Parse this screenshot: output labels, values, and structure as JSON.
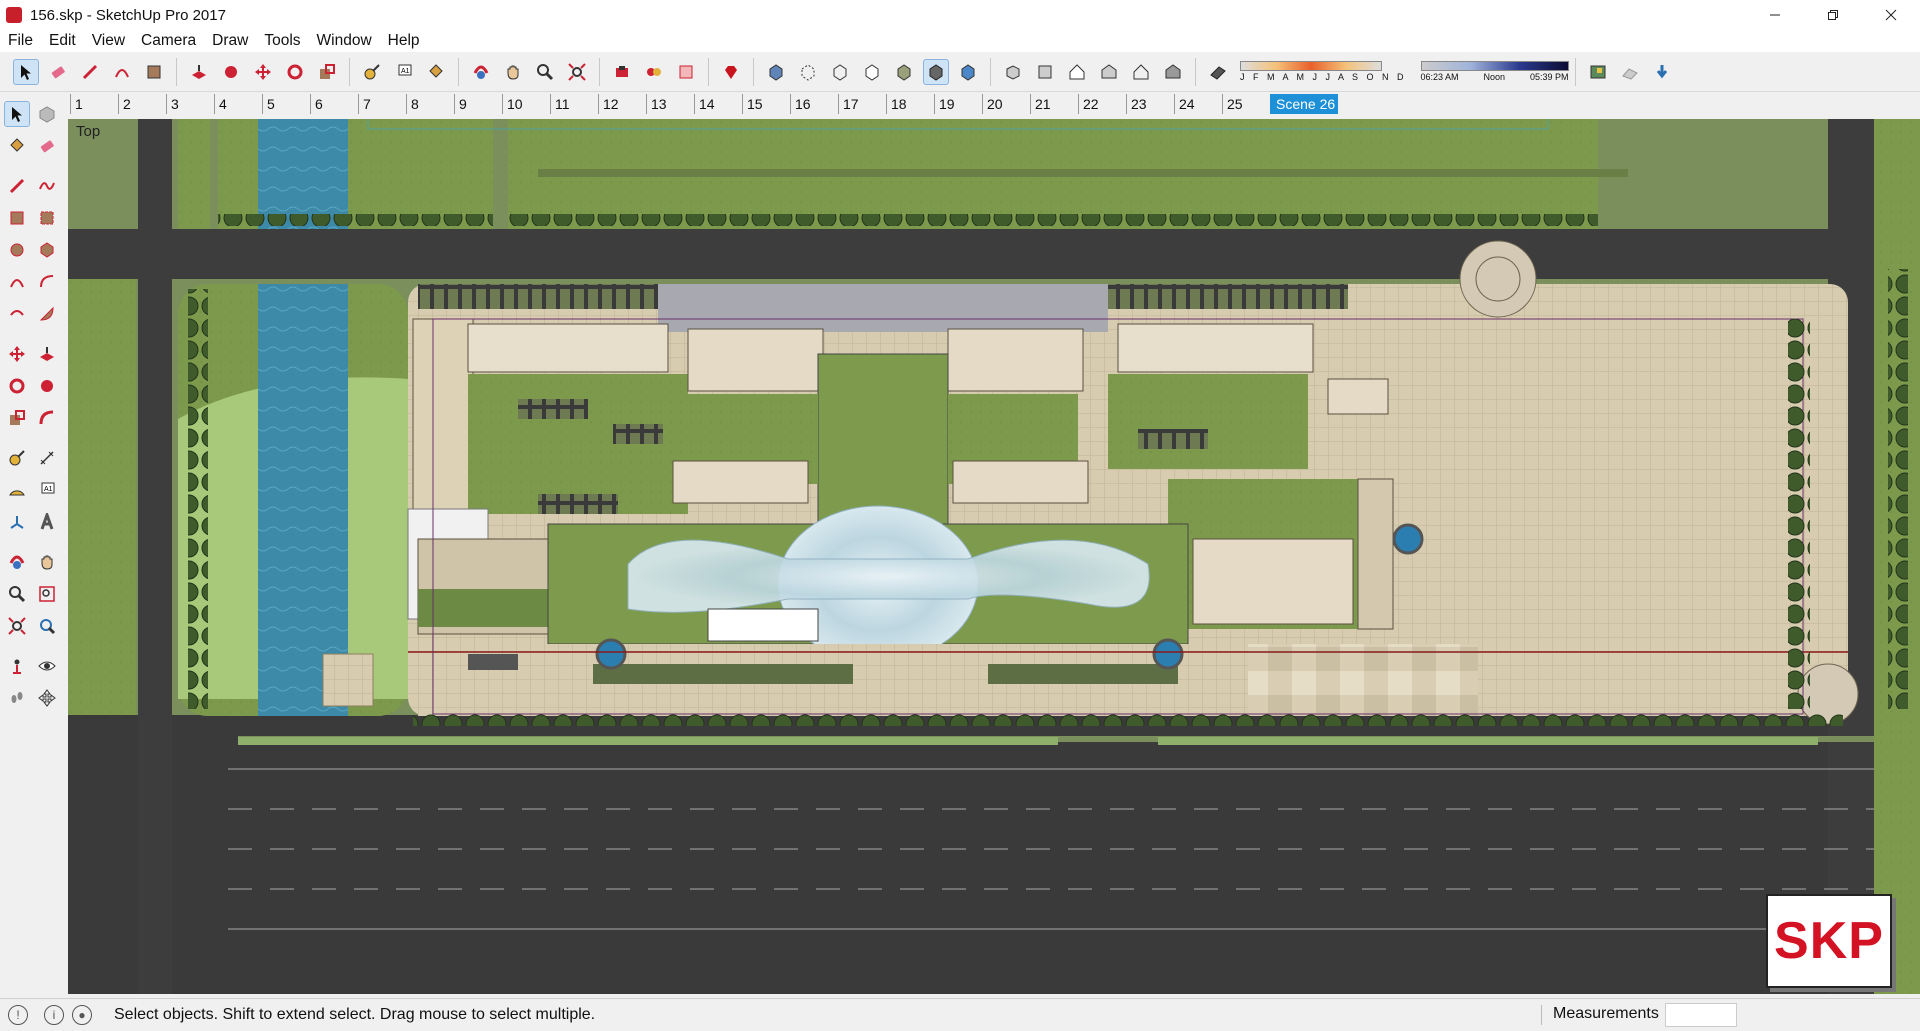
{
  "window": {
    "title": "156.skp - SketchUp Pro 2017",
    "controls": [
      "minimize-icon",
      "maximize-icon",
      "close-icon"
    ]
  },
  "menu": [
    "File",
    "Edit",
    "View",
    "Camera",
    "Draw",
    "Tools",
    "Window",
    "Help"
  ],
  "shadow": {
    "months": "J F M A M J J A S O N D",
    "time_start": "06:23 AM",
    "time_noon": "Noon",
    "time_end": "05:39 PM"
  },
  "scenes": [
    "1",
    "2",
    "3",
    "4",
    "5",
    "6",
    "7",
    "8",
    "9",
    "10",
    "11",
    "12",
    "13",
    "14",
    "15",
    "16",
    "17",
    "18",
    "19",
    "20",
    "21",
    "22",
    "23",
    "24",
    "25",
    "Scene 26"
  ],
  "active_scene": "Scene 26",
  "viewport": {
    "view_label": "Top",
    "badge": "SKP"
  },
  "status": {
    "message": "Select objects. Shift to extend select. Drag mouse to select multiple.",
    "measurements_label": "Measurements"
  },
  "colors": {
    "accent": "#1e90d8",
    "badge_red": "#d31224",
    "lawn": "#7c9a4e",
    "water": "#3f8fae",
    "road": "#3c3c3c"
  }
}
